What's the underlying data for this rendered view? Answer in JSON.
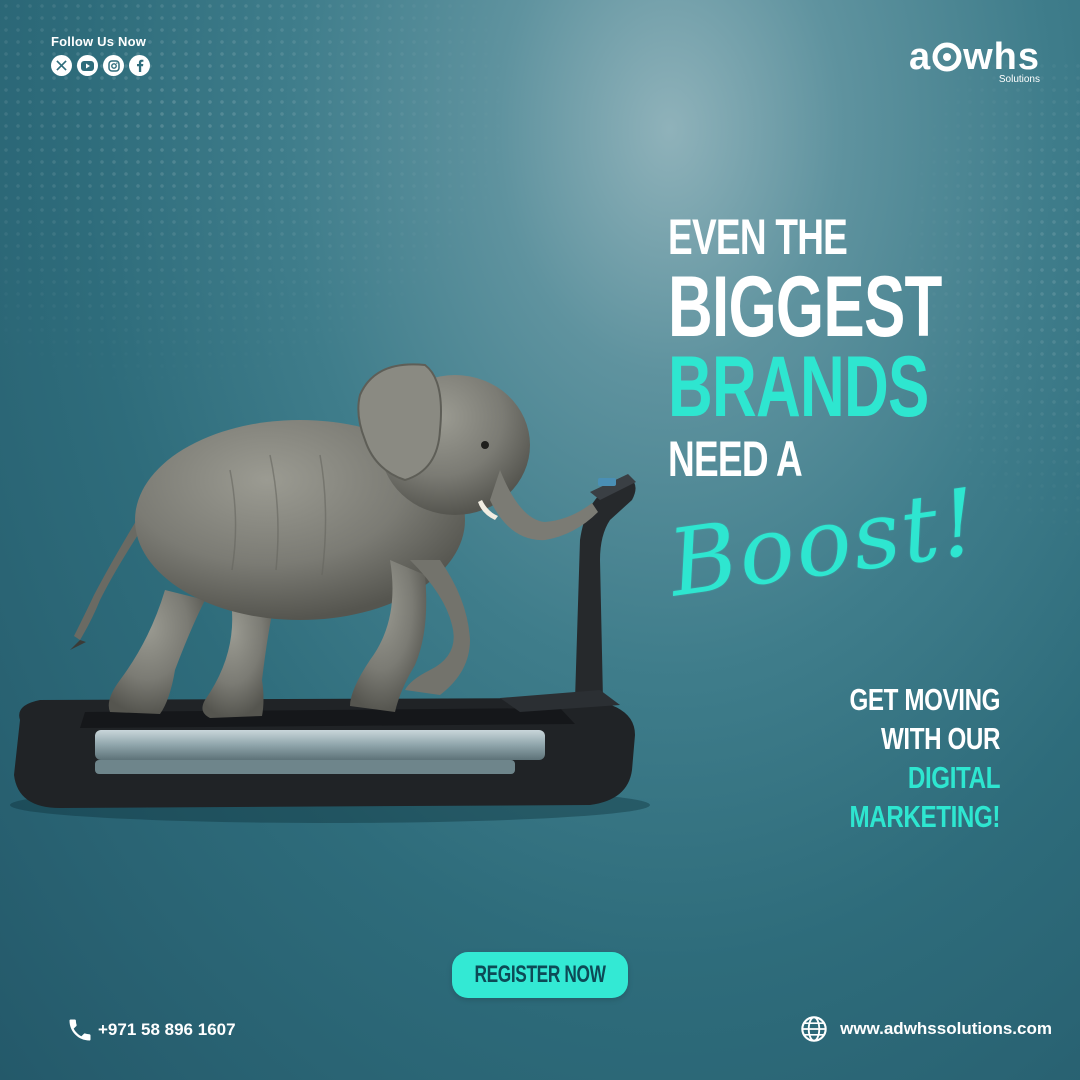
{
  "header": {
    "follow_label": "Follow Us Now",
    "social_icons": [
      "x-icon",
      "youtube-icon",
      "instagram-icon",
      "facebook-icon"
    ]
  },
  "logo": {
    "word_start": "a",
    "word_end": "whs",
    "subtitle": "Solutions"
  },
  "headline": {
    "line1": "EVEN THE",
    "line2": "BIGGEST",
    "line3": "BRANDS",
    "line4": "NEED A",
    "script_word": "Boost!"
  },
  "subheadline": {
    "line1": "GET MOVING",
    "line2": "WITH OUR",
    "line3": "DIGITAL",
    "line4": "MARKETING!"
  },
  "cta": {
    "label": "REGISTER NOW"
  },
  "contact": {
    "phone": "+971 58 896 1607",
    "website": "www.adwhssolutions.com"
  },
  "colors": {
    "accent": "#2ee6d0",
    "background": "#2e6c7b",
    "text": "#ffffff"
  }
}
